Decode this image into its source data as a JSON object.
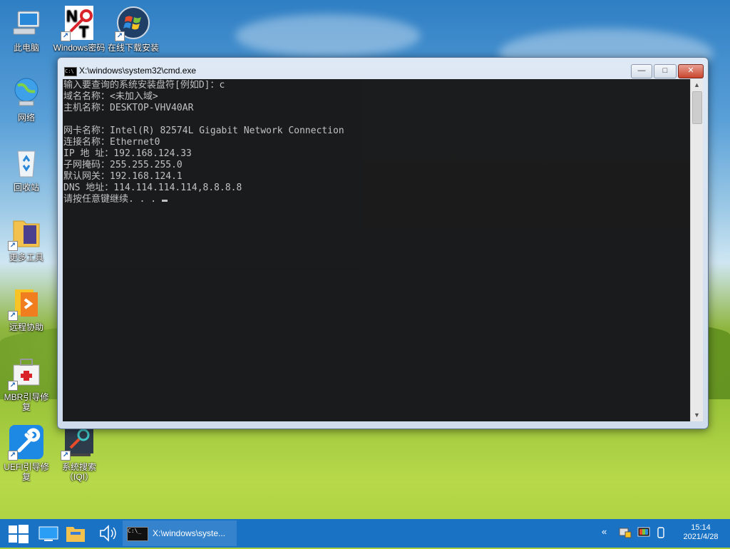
{
  "desktop": {
    "icons": [
      {
        "label": "此电脑",
        "icon": "computer-icon"
      },
      {
        "label": "Windows密码修改",
        "icon": "nt-password-icon"
      },
      {
        "label": "在线下载安装",
        "icon": "windows-logo-icon"
      },
      {
        "label": "网络",
        "icon": "network-globe-icon"
      },
      {
        "label": "回收站",
        "icon": "recycle-bin-icon"
      },
      {
        "label": "更多工具",
        "icon": "folder-icon"
      },
      {
        "label": "远程协助",
        "icon": "remote-assist-icon"
      },
      {
        "label": "MBR引导修复",
        "icon": "toolbox-icon"
      },
      {
        "label": "UEFI引导修复",
        "icon": "wrench-icon"
      },
      {
        "label": "系统搜索（IQI）",
        "icon": "system-search-icon"
      }
    ]
  },
  "window": {
    "title": "X:\\windows\\system32\\cmd.exe",
    "buttons": {
      "minimize": "—",
      "maximize": "□",
      "close": "✕"
    },
    "console_lines": [
      "输入要查询的系统安装盘符[例如D]：c",
      "域名名称：<未加入域>",
      "主机名称：DESKTOP-VHV40AR",
      "",
      "网卡名称：Intel(R) 82574L Gigabit Network Connection",
      "连接名称：Ethernet0",
      "IP 地 址：192.168.124.33",
      "子网掩码：255.255.255.0",
      "默认网关：192.168.124.1",
      "DNS 地址：114.114.114.114,8.8.8.8",
      "请按任意键继续. . . "
    ]
  },
  "taskbar": {
    "task_label": "X:\\windows\\syste...",
    "task_icon_text": "C:\\_",
    "clock_time": "15:14",
    "clock_date": "2021/4/28"
  }
}
